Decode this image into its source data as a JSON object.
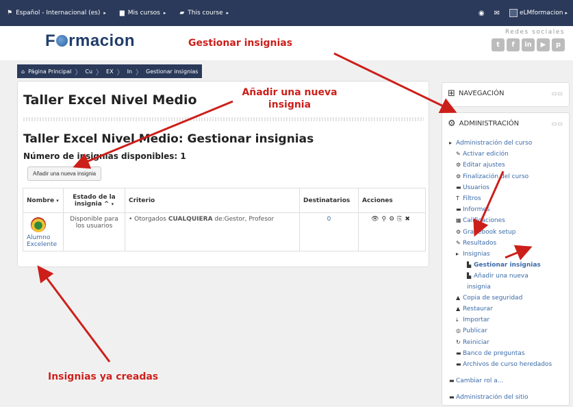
{
  "navbar": {
    "language": "Español - Internacional (es)",
    "my_courses": "Mis cursos",
    "this_course": "This course",
    "user": "eLMformacion"
  },
  "header": {
    "logo_before": "F",
    "logo_after": "rmacion",
    "social_title": "Redes sociales",
    "social_icons": [
      "twitter-icon",
      "facebook-icon",
      "linkedin-icon",
      "youtube-icon",
      "pinterest-icon"
    ]
  },
  "breadcrumb": [
    "Página Principal",
    "Cu",
    "EX",
    "In",
    "Gestionar insignias"
  ],
  "main": {
    "course_title": "Taller Excel Nivel Medio",
    "page_heading": "Taller Excel Nivel Medio: Gestionar insignias",
    "count_heading": "Número de insignias disponibles: 1",
    "add_button": "Añadir una nueva insignia",
    "table": {
      "headers": {
        "name": "Nombre",
        "status": "Estado de la insignia ^",
        "criteria": "Criterio",
        "recipients": "Destinatarios",
        "actions": "Acciones"
      },
      "row": {
        "name": "Alumno Excelente",
        "status": "Disponible para los usuarios",
        "criteria_prefix": "Otorgados ",
        "criteria_strong": "CUALQUIERA",
        "criteria_suffix": " de:Gestor, Profesor",
        "recipients": "0"
      }
    }
  },
  "sidebar": {
    "navigation_title": "NAVEGACIÓN",
    "admin_title": "ADMINISTRACIÓN",
    "admin_items": {
      "course_admin": "Administración del curso",
      "edit_on": "Activar edición",
      "edit_settings": "Editar ajustes",
      "completion": "Finalización del curso",
      "users": "Usuarios",
      "filters": "Filtros",
      "reports": "Informes",
      "grades": "Calificaciones",
      "gradebook": "Gradebook setup",
      "outcomes": "Resultados",
      "badges": "Insignias",
      "manage_badges": "Gestionar insignias",
      "add_badge": "Añadir una nueva insignia",
      "backup": "Copia de seguridad",
      "restore": "Restaurar",
      "import": "Importar",
      "publish": "Publicar",
      "reset": "Reiniciar",
      "question_bank": "Banco de preguntas",
      "legacy_files": "Archivos de curso heredados",
      "switch_role": "Cambiar rol a...",
      "site_admin": "Administración del sitio"
    }
  },
  "annotations": {
    "manage": "Gestionar insignias",
    "add_line1": "Añadir una nueva",
    "add_line2": "insignia",
    "existing": "Insignias ya creadas"
  },
  "colors": {
    "navbar": "#2b3a5a",
    "annotation": "#cc1f1a",
    "link": "#3a6aa8"
  }
}
